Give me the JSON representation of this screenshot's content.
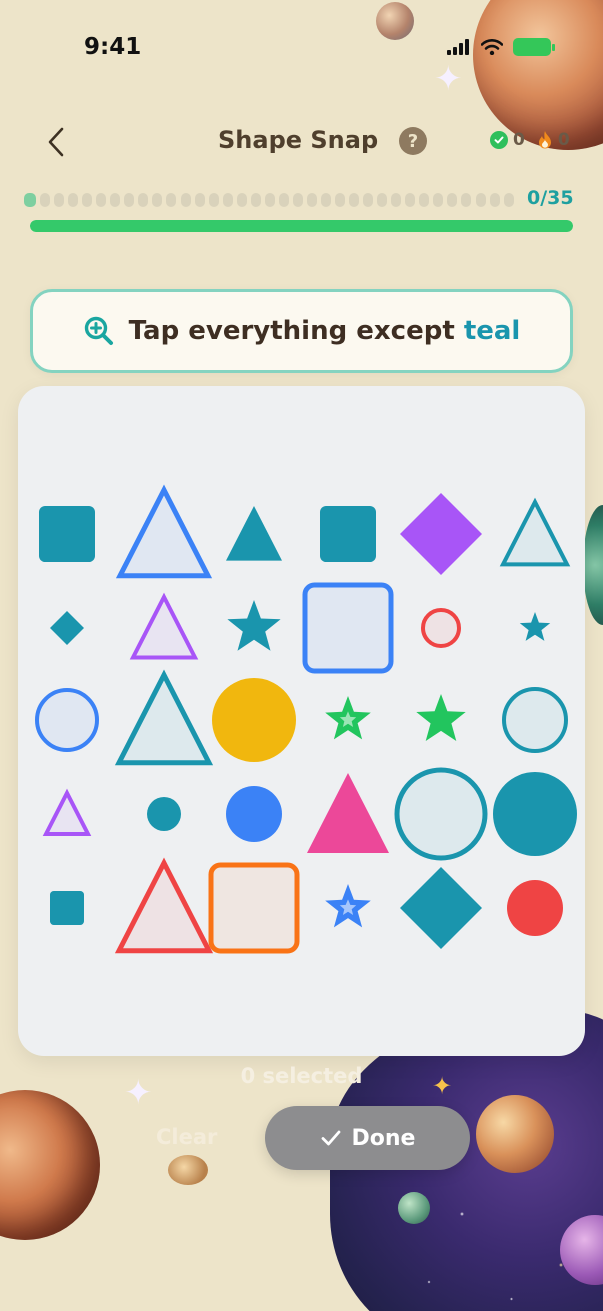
{
  "status": {
    "time": "9:41"
  },
  "header": {
    "title": "Shape Snap",
    "help_label": "?",
    "correct_count": "0",
    "streak_count": "0"
  },
  "progress": {
    "count_label": "0/35",
    "current": 0,
    "total": 35,
    "fraction": 0
  },
  "instruction": {
    "prefix": "Tap everything except ",
    "target": "teal",
    "icon": "magnifier-plus-icon"
  },
  "shapes": [
    {
      "kind": "square",
      "color": "#1a95ad",
      "style": "filled"
    },
    {
      "kind": "triangle",
      "color": "#3b82f6",
      "style": "outline"
    },
    {
      "kind": "triangle",
      "color": "#1a95ad",
      "style": "filled"
    },
    {
      "kind": "square",
      "color": "#1a95ad",
      "style": "filled"
    },
    {
      "kind": "diamond",
      "color": "#a855f7",
      "style": "filled"
    },
    {
      "kind": "triangle",
      "color": "#1a95ad",
      "style": "outline"
    },
    {
      "kind": "diamond",
      "color": "#1a95ad",
      "style": "filled"
    },
    {
      "kind": "triangle",
      "color": "#a855f7",
      "style": "outline"
    },
    {
      "kind": "star",
      "color": "#1a95ad",
      "style": "filled"
    },
    {
      "kind": "square",
      "color": "#3b82f6",
      "style": "outline"
    },
    {
      "kind": "circle",
      "color": "#ef4444",
      "style": "outline"
    },
    {
      "kind": "star",
      "color": "#1a95ad",
      "style": "filled"
    },
    {
      "kind": "circle",
      "color": "#3b82f6",
      "style": "outline"
    },
    {
      "kind": "triangle",
      "color": "#1a95ad",
      "style": "outline"
    },
    {
      "kind": "circle",
      "color": "#f1b70e",
      "style": "filled"
    },
    {
      "kind": "star",
      "color": "#22c55e",
      "style": "filled-inner"
    },
    {
      "kind": "star",
      "color": "#22c55e",
      "style": "filled"
    },
    {
      "kind": "circle",
      "color": "#1a95ad",
      "style": "outline"
    },
    {
      "kind": "triangle",
      "color": "#a855f7",
      "style": "outline"
    },
    {
      "kind": "circle",
      "color": "#1a95ad",
      "style": "filled"
    },
    {
      "kind": "circle",
      "color": "#3b82f6",
      "style": "filled"
    },
    {
      "kind": "triangle",
      "color": "#ec4899",
      "style": "filled"
    },
    {
      "kind": "circle",
      "color": "#1a95ad",
      "style": "outline"
    },
    {
      "kind": "circle",
      "color": "#1a95ad",
      "style": "filled"
    },
    {
      "kind": "square",
      "color": "#1a95ad",
      "style": "filled"
    },
    {
      "kind": "triangle",
      "color": "#ef4444",
      "style": "outline"
    },
    {
      "kind": "square",
      "color": "#f97316",
      "style": "outline"
    },
    {
      "kind": "star",
      "color": "#3b82f6",
      "style": "filled-inner"
    },
    {
      "kind": "diamond",
      "color": "#1a95ad",
      "style": "filled"
    },
    {
      "kind": "circle",
      "color": "#ef4444",
      "style": "filled"
    }
  ],
  "footer": {
    "selected_label": "0 selected",
    "clear_label": "Clear",
    "done_label": "Done"
  },
  "colors": {
    "accent": "#1a95ad",
    "progress_fill": "#34c96a",
    "done_button": "#8d8d8f"
  }
}
